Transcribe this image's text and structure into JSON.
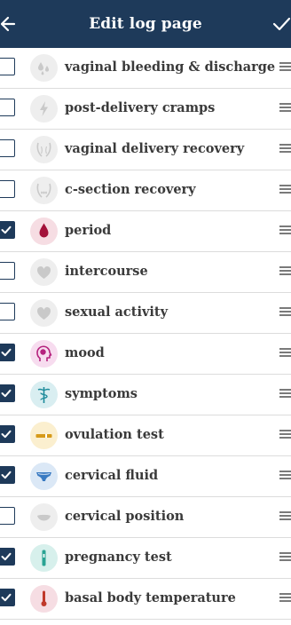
{
  "header": {
    "title": "Edit log page",
    "back_icon": "arrow-left-icon",
    "confirm_icon": "checkmark-icon",
    "background_color": "#1e3a5a"
  },
  "items": [
    {
      "label": "vaginal bleeding & discharge",
      "checked": false,
      "icon": "droplets-icon",
      "icon_bg": "#eeeeee",
      "icon_color": "#c9c9c9"
    },
    {
      "label": "post-delivery cramps",
      "checked": false,
      "icon": "lightning-icon",
      "icon_bg": "#eeeeee",
      "icon_color": "#c9c9c9"
    },
    {
      "label": "vaginal delivery recovery",
      "checked": false,
      "icon": "pelvis-icon",
      "icon_bg": "#eeeeee",
      "icon_color": "#c9c9c9"
    },
    {
      "label": "c-section recovery",
      "checked": false,
      "icon": "pelvis-incision-icon",
      "icon_bg": "#eeeeee",
      "icon_color": "#c9c9c9"
    },
    {
      "label": "period",
      "checked": true,
      "icon": "blood-drop-icon",
      "icon_bg": "#f6dde3",
      "icon_color": "#a3123a"
    },
    {
      "label": "intercourse",
      "checked": false,
      "icon": "heart-icon",
      "icon_bg": "#eeeeee",
      "icon_color": "#c9c9c9"
    },
    {
      "label": "sexual activity",
      "checked": false,
      "icon": "heart-icon",
      "icon_bg": "#eeeeee",
      "icon_color": "#c9c9c9"
    },
    {
      "label": "mood",
      "checked": true,
      "icon": "head-brain-icon",
      "icon_bg": "#f7dcef",
      "icon_color": "#b5227e"
    },
    {
      "label": "symptoms",
      "checked": true,
      "icon": "caduceus-icon",
      "icon_bg": "#d9eef1",
      "icon_color": "#1b8a9a"
    },
    {
      "label": "ovulation test",
      "checked": true,
      "icon": "test-strip-icon",
      "icon_bg": "#fbefcf",
      "icon_color": "#d69a19"
    },
    {
      "label": "cervical fluid",
      "checked": true,
      "icon": "underwear-icon",
      "icon_bg": "#dbe8f6",
      "icon_color": "#3a7bc2"
    },
    {
      "label": "cervical position",
      "checked": false,
      "icon": "cervix-icon",
      "icon_bg": "#eeeeee",
      "icon_color": "#c9c9c9"
    },
    {
      "label": "pregnancy test",
      "checked": true,
      "icon": "pregnancy-test-icon",
      "icon_bg": "#d7f0ec",
      "icon_color": "#2aa393"
    },
    {
      "label": "basal body temperature",
      "checked": true,
      "icon": "thermometer-icon",
      "icon_bg": "#f6dde3",
      "icon_color": "#c0392b"
    }
  ]
}
